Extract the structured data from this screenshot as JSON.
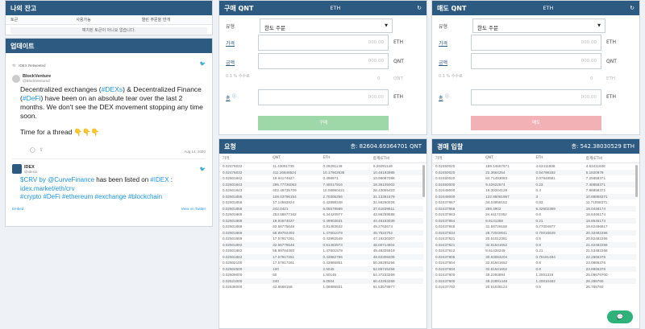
{
  "wallet": {
    "title": "나의 잔고",
    "tabs": [
      "토큰",
      "사용가능",
      "열린 주문을 만개"
    ],
    "message": "예치된 토큰이 아니요 없습니다."
  },
  "updates": {
    "title": "업데이트",
    "tweet1": {
      "retweet_label": "IDEX Retweeted",
      "name": "BlockVenture",
      "handle": "@BlockVentured",
      "text_a": "Decentralized exchanges (",
      "tag1": "#DEXs",
      "text_b": ") & Decentralized Finance (",
      "tag2": "#DeFi",
      "text_c": ") have been on an absolute tear over the last 2 months. We don't see the DEX movement stopping any time soon.",
      "text_d": "Time for a thread 👇👇👇",
      "date": "Aug 14, 2020"
    },
    "tweet2": {
      "name": "IDEX",
      "handle": "@idexio",
      "text_a": "$CRV by ",
      "mention": "@CurveFinance",
      "text_b": " has been listed on ",
      "tag": "#IDEX",
      "text_c": " :",
      "link": "idex.market/eth/crv",
      "tags": "#crypto #DeFi #ethereum #exchange #blockchain"
    },
    "embed_label": "Embed",
    "view_label": "View on Twitter"
  },
  "buy_form": {
    "title": "구매 QNT",
    "market": "ETH",
    "type_label": "유형",
    "type_value": "한도 주문",
    "price_label": "가격",
    "price_value": "000.00",
    "price_unit": "ETH",
    "amount_label": "금액",
    "amount_value": "000.00",
    "amount_unit": "QNT",
    "fee_label": "0.1 % 수수료",
    "fee_value": "0",
    "fee_unit": "QNT",
    "total_label": "총",
    "total_value": "000.00",
    "total_unit": "ETH",
    "button": "구매"
  },
  "sell_form": {
    "title": "매도 QNT",
    "market": "ETH",
    "type_label": "유형",
    "type_value": "한도 주문",
    "price_label": "가격",
    "price_value": "000.00",
    "price_unit": "ETH",
    "amount_label": "금액",
    "amount_value": "000.00",
    "amount_unit": "QNT",
    "fee_label": "0.1 % 수수료",
    "fee_value": "0",
    "fee_unit": "ETH",
    "total_label": "총",
    "total_value": "000.00",
    "total_unit": "ETH",
    "button": "매도"
  },
  "buy_book": {
    "title": "요청",
    "total": "총: 82604.69364701 QNT",
    "columns": [
      "가격",
      "QNT",
      "ETH",
      "합계(ETH)"
    ],
    "rows": [
      [
        "0.02475032",
        "11.43061749",
        "0.29291149",
        "0.29291149"
      ],
      [
        "0.02475032",
        "411.26848524",
        "10.17902636",
        "10.46193985"
      ],
      [
        "0.02501842",
        "19.9417492?",
        "0.4989?1",
        "10.96087086"
      ],
      [
        "0.02501843",
        "295.77726063",
        "7.40017916",
        "18.36105002"
      ],
      [
        "0.02501843",
        "402.48735709",
        "10.06950421",
        "28.43055423"
      ],
      [
        "0.02501855",
        "108.03796154",
        "2.70306256",
        "31.13361679"
      ],
      [
        "0.02501855",
        "17.14592824",
        "0.42898348",
        "31.56260026"
      ],
      [
        "0.02501855",
        "242.0421",
        "6.05578586",
        "37.61839611"
      ],
      [
        "0.02501868",
        "253.58877162",
        "6.34420977",
        "43.96259588"
      ],
      [
        "0.02501868",
        "19.94574027",
        "0.49903631",
        "44.46163039"
      ],
      [
        "0.02501869",
        "32.56775648",
        "0.81483532",
        "45.2763674"
      ],
      [
        "0.02501869",
        "58.99784493",
        "1.47601079",
        "46.7524752"
      ],
      [
        "0.02501869",
        "17.5791?261",
        "0.43982549",
        "47.19230307"
      ],
      [
        "0.02501882",
        "32.56778546",
        "0.81483973",
        "48.00714804"
      ],
      [
        "0.02501882",
        "58.99784493",
        "1.47601579",
        "49.48325919"
      ],
      [
        "0.02501882",
        "17.57917261",
        "0.43982796",
        "49.92308405"
      ],
      [
        "0.02502100",
        "17.57917261",
        "0.43986851",
        "50.36295256"
      ],
      [
        "0.02504500",
        "100",
        "2.5045",
        "52.86745256"
      ],
      [
        "0.02509000",
        "60",
        "1.50145",
        "54.37223259"
      ],
      [
        "0.02521000",
        "240",
        "6.0504",
        "60.42263259"
      ],
      [
        "0.02538000",
        "42.8668158",
        "1.08886831",
        "61.53578977"
      ]
    ]
  },
  "sell_book": {
    "title": "경매 입찰",
    "total": "총: 542.38030529 ETH",
    "columns": [
      "가격",
      "QNT",
      "ETH",
      "합계(ETH)"
    ],
    "rows": [
      [
        "0.02450020",
        "189.14667671",
        "4.63411608",
        "4.63411608"
      ],
      [
        "0.02450020",
        "22.3664254",
        "0.54798182",
        "5.1820979"
      ],
      [
        "0.02450020",
        "84.71493083",
        "2.07648581",
        "7.25858371"
      ],
      [
        "0.02450000",
        "9.42622674",
        "0.23",
        "7.48858371"
      ],
      [
        "0.02449000",
        "16.39344128",
        "0.4",
        "7.88858371"
      ],
      [
        "0.02449000",
        "122.95081967",
        "3",
        "10.88858371"
      ],
      [
        "0.02437867",
        "34.04858152",
        "0.83",
        "11.71858371"
      ],
      [
        "0.02437866",
        "259.4902",
        "6.32602369",
        "18.0446174"
      ],
      [
        "0.02437863",
        "24.61172352",
        "0.6",
        "18.6446174"
      ],
      [
        "0.02437854",
        "8.6141358",
        "0.21",
        "18.8546174"
      ],
      [
        "0.02437846",
        "31.58726156",
        "0.77004977",
        "19.62466617"
      ],
      [
        "0.02437834",
        "28.72040641",
        "0.70016849",
        "20.32482266"
      ],
      [
        "0.02437821",
        "20.51012361",
        "0.5",
        "20.82482266"
      ],
      [
        "0.02437821",
        "32.81641652",
        "0.8",
        "21.62482266"
      ],
      [
        "0.02437812",
        "8.61428249",
        "0.21",
        "21.53482266"
      ],
      [
        "0.02437805",
        "30.83083204",
        "0.75181494",
        "22.2866376"
      ],
      [
        "0.02437804",
        "32.81641652",
        "0.8",
        "23.0866376"
      ],
      [
        "0.02437804",
        "32.81641652",
        "0.8",
        "23.8866376"
      ],
      [
        "0.02437800",
        "49.2293894",
        "1.2001318",
        "25.08676?00"
      ],
      [
        "0.02437800",
        "49.22891448",
        "1.20010482",
        "26.286760"
      ],
      [
        "0.02437792",
        "20.51036124",
        "0.5",
        "26.786760"
      ]
    ]
  },
  "chat_label": "💬"
}
